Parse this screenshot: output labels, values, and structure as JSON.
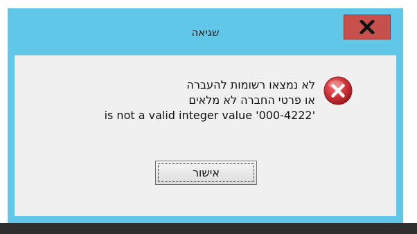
{
  "dialog": {
    "title": "שגיאה",
    "close_icon": "close-x-icon",
    "status_icon": "error-icon",
    "message_lines": [
      "לא נמצאו רשומות להעברה",
      "או פרטי החברה לא מלאים",
      "is not a valid integer value '000-4222'"
    ],
    "ok_label": "אישור"
  },
  "colors": {
    "title_bar": "#60c7e8",
    "close_button": "#c7504d",
    "client_area": "#f0f0f0",
    "error_red": "#d3363b"
  }
}
